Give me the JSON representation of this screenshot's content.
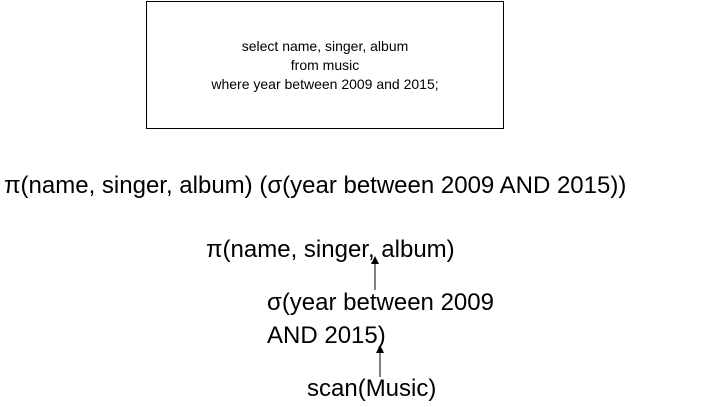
{
  "sql_box": {
    "lines": [
      "select name, singer, album",
      "from music",
      "where year between 2009 and 2015;"
    ]
  },
  "relational_algebra": {
    "expression": "π(name, singer, album) (σ(year between 2009 AND 2015))"
  },
  "query_tree": {
    "projection": "π(name, singer, album)",
    "selection_line1": "σ(year between 2009",
    "selection_line2": "AND 2015)",
    "scan": "scan(Music)"
  },
  "colors": {
    "stroke": "#000000",
    "background": "#ffffff"
  }
}
